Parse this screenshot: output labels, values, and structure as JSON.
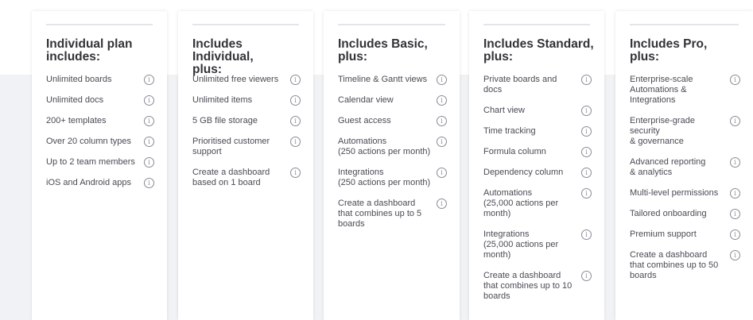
{
  "plans": [
    {
      "heading": "Individual plan\nincludes:",
      "features": [
        "Unlimited boards",
        "Unlimited docs",
        "200+ templates",
        "Over 20 column types",
        "Up to 2 team members",
        "iOS and Android apps"
      ]
    },
    {
      "heading": "Includes Individual,\nplus:",
      "features": [
        "Unlimited free viewers",
        "Unlimited items",
        "5 GB file storage",
        "Prioritised customer\nsupport",
        "Create a dashboard\nbased on 1 board"
      ]
    },
    {
      "heading": "Includes Basic,\nplus:",
      "features": [
        "Timeline & Gantt views",
        "Calendar view",
        "Guest access",
        "Automations\n(250 actions per month)",
        "Integrations\n(250 actions per month)",
        "Create a dashboard\nthat combines up to 5\nboards"
      ]
    },
    {
      "heading": "Includes Standard,\nplus:",
      "features": [
        "Private boards and\ndocs",
        "Chart view",
        "Time tracking",
        "Formula column",
        "Dependency column",
        "Automations\n(25,000 actions per\nmonth)",
        "Integrations\n(25,000 actions per\nmonth)",
        "Create a dashboard\nthat combines up to 10\nboards"
      ]
    },
    {
      "heading": "Includes Pro,\nplus:",
      "features": [
        "Enterprise-scale\nAutomations &\nIntegrations",
        "Enterprise-grade\nsecurity\n& governance",
        "Advanced reporting\n& analytics",
        "Multi-level permissions",
        "Tailored onboarding",
        "Premium support",
        "Create a dashboard\nthat combines up to 50\nboards"
      ]
    }
  ],
  "info_glyph": "i",
  "info_icon": "info-circle-icon",
  "colors": {
    "band": "#f1f2f5",
    "card": "#ffffff",
    "heading": "#323338",
    "text": "#4a4a55",
    "icon": "#8a8a95"
  }
}
